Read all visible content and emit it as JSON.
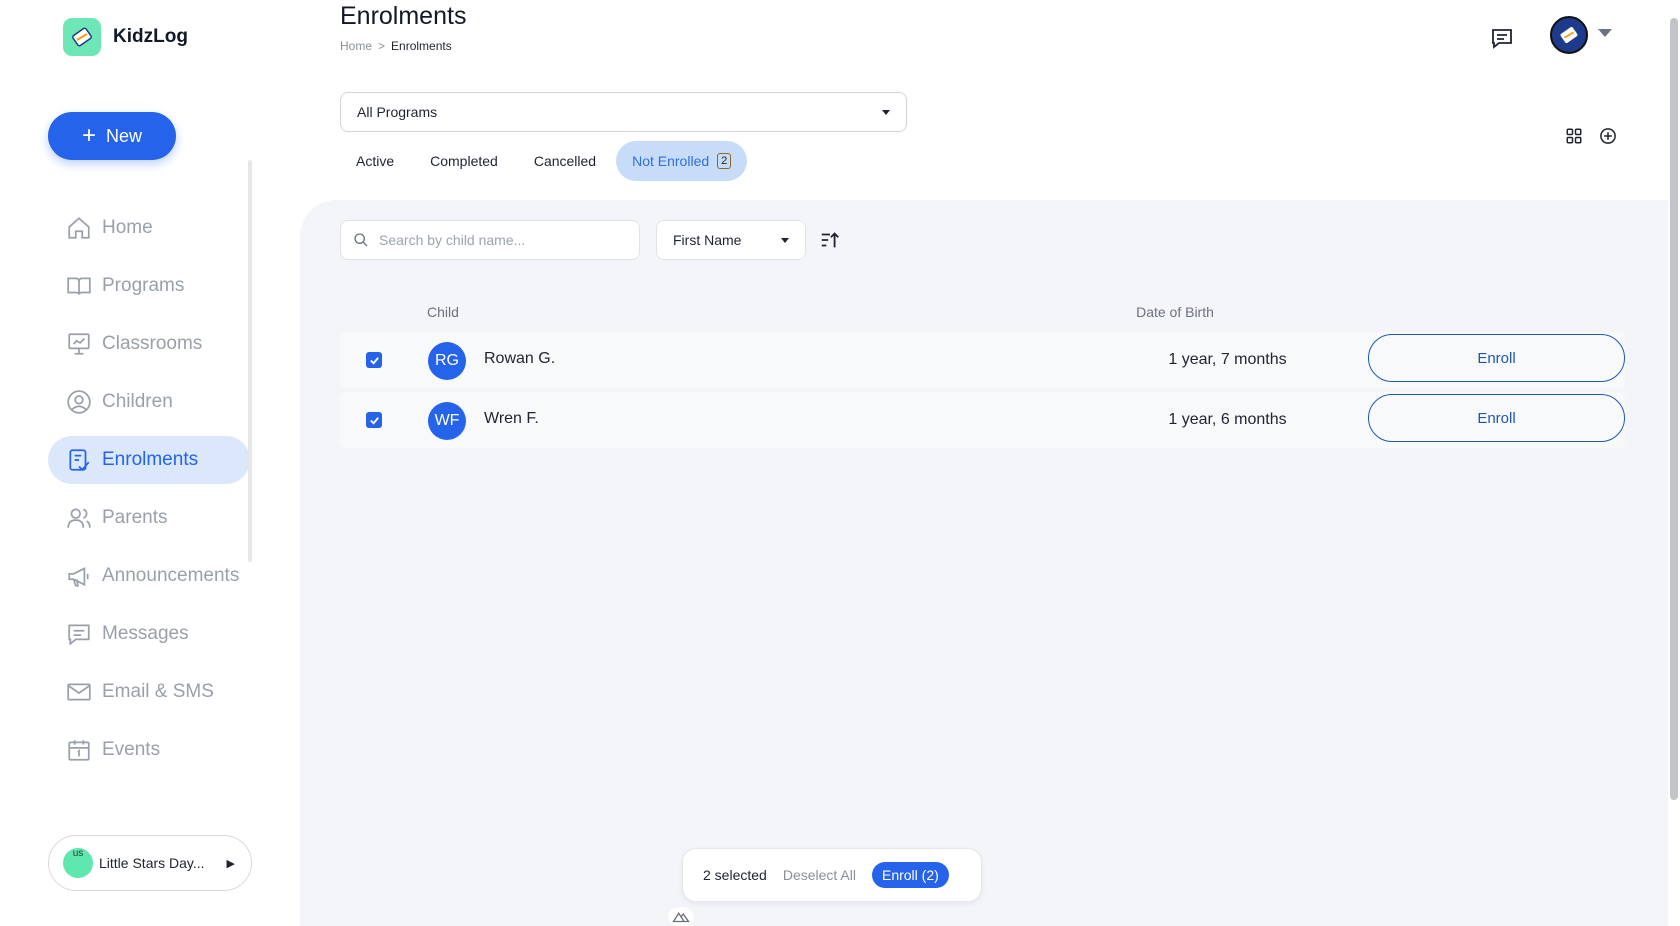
{
  "app": {
    "name": "KidzLog"
  },
  "sidebar": {
    "new_label": "New",
    "items": [
      {
        "label": "Home",
        "icon": "home-icon"
      },
      {
        "label": "Programs",
        "icon": "book-icon"
      },
      {
        "label": "Classrooms",
        "icon": "presentation-icon"
      },
      {
        "label": "Children",
        "icon": "user-circle-icon"
      },
      {
        "label": "Enrolments",
        "icon": "enrolment-icon",
        "active": true
      },
      {
        "label": "Parents",
        "icon": "users-icon"
      },
      {
        "label": "Announcements",
        "icon": "megaphone-icon"
      },
      {
        "label": "Messages",
        "icon": "message-icon"
      },
      {
        "label": "Email & SMS",
        "icon": "mail-icon"
      },
      {
        "label": "Events",
        "icon": "calendar-icon"
      }
    ],
    "org": {
      "name": "Little Stars Day...",
      "avatar_alt": "us"
    }
  },
  "header": {
    "title": "Enrolments",
    "breadcrumb": {
      "home": "Home",
      "separator": ">",
      "current": "Enrolments"
    }
  },
  "filters": {
    "program": "All Programs",
    "tabs": [
      {
        "label": "Active"
      },
      {
        "label": "Completed"
      },
      {
        "label": "Cancelled"
      },
      {
        "label": "Not Enrolled",
        "count": "2",
        "active": true
      }
    ],
    "search_placeholder": "Search by child name...",
    "sort_field": "First Name"
  },
  "table": {
    "columns": {
      "child": "Child",
      "dob": "Date of Birth"
    },
    "rows": [
      {
        "initials": "RG",
        "name": "Rowan G.",
        "dob": "1 year, 7 months",
        "action": "Enroll",
        "checked": true
      },
      {
        "initials": "WF",
        "name": "Wren F.",
        "dob": "1 year, 6 months",
        "action": "Enroll",
        "checked": true
      }
    ]
  },
  "bulk": {
    "selected": "2 selected",
    "deselect": "Deselect All",
    "enroll": "Enroll (2)"
  },
  "colors": {
    "accent": "#2563eb",
    "active_nav_bg": "#dbe7fb",
    "panel_bg": "#f3f5f8",
    "logo_bg": "#6ee7b7"
  }
}
